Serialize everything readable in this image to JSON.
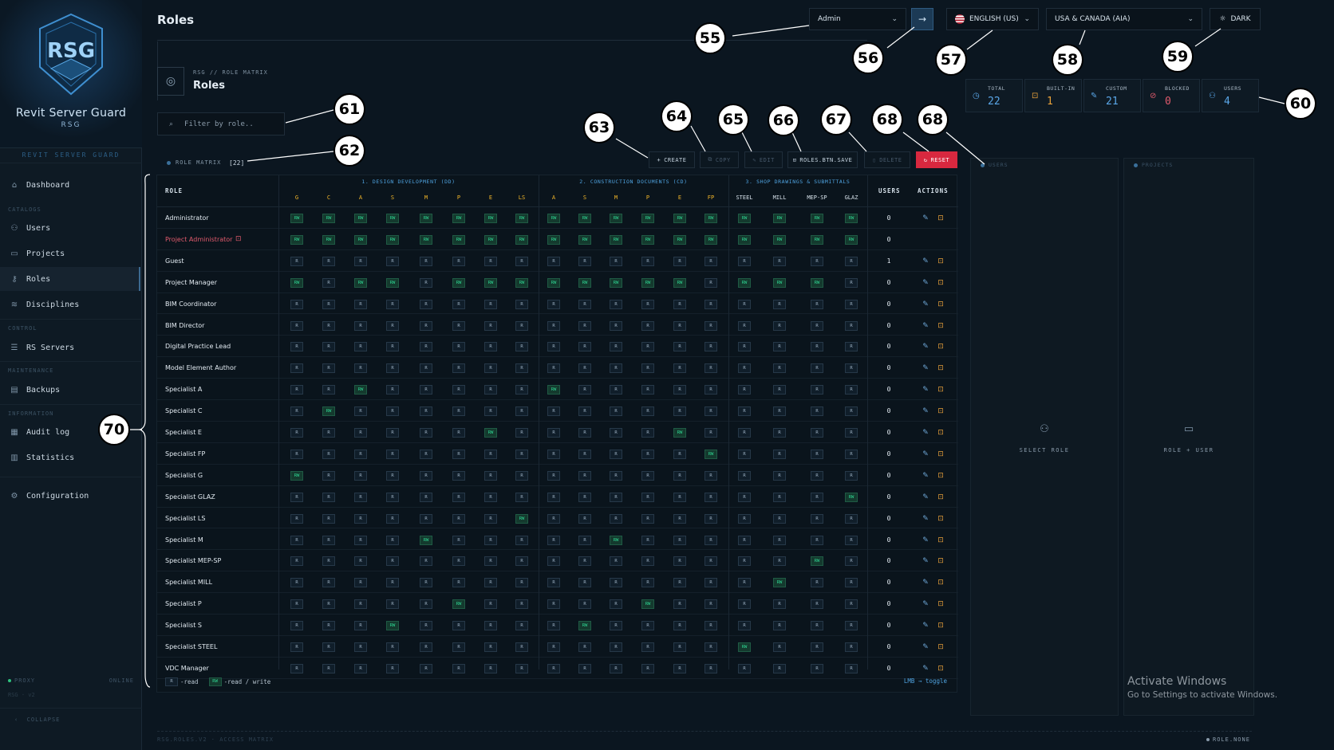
{
  "app": {
    "brand_title": "Revit Server Guard",
    "brand_subtitle": "RSG",
    "brand_caption": "REVIT SERVER GUARD"
  },
  "sidebar": {
    "sections": [
      {
        "label": "CATALOGS"
      },
      {
        "label": "CONTROL"
      },
      {
        "label": "MAINTENANCE"
      },
      {
        "label": "INFORMATION"
      }
    ],
    "items": [
      {
        "label": "Dashboard",
        "icon": "home-icon"
      },
      {
        "label": "Users",
        "icon": "users-icon"
      },
      {
        "label": "Projects",
        "icon": "folder-icon"
      },
      {
        "label": "Roles",
        "icon": "key-icon",
        "active": true
      },
      {
        "label": "Disciplines",
        "icon": "layers-icon"
      },
      {
        "label": "RS Servers",
        "icon": "server-icon"
      },
      {
        "label": "Backups",
        "icon": "archive-icon"
      },
      {
        "label": "Audit log",
        "icon": "log-icon"
      },
      {
        "label": "Statistics",
        "icon": "chart-icon"
      },
      {
        "label": "Configuration",
        "icon": "gear-icon"
      }
    ],
    "status_left": "PROXY",
    "status_right": "ONLINE",
    "version": "RSG · v2",
    "collapse_label": "COLLAPSE"
  },
  "header": {
    "page_title": "Roles",
    "user_select": "Admin",
    "language": "ENGLISH (US)",
    "region": "USA & CANADA (AIA)",
    "theme_label": "DARK",
    "crumb": "RSG // ROLE MATRIX",
    "section_title": "Roles"
  },
  "search": {
    "placeholder": "Filter by role.."
  },
  "stats": [
    {
      "label": "TOTAL",
      "value": "22",
      "color": "#5aa7e8",
      "icon": "clock-icon"
    },
    {
      "label": "BUILT-IN",
      "value": "1",
      "color": "#e8a13a",
      "icon": "lock-icon"
    },
    {
      "label": "CUSTOM",
      "value": "21",
      "color": "#5aa7e8",
      "icon": "pencil-icon"
    },
    {
      "label": "BLOCKED",
      "value": "0",
      "color": "#e05a6c",
      "icon": "block-icon"
    },
    {
      "label": "USERS",
      "value": "4",
      "color": "#5aa7e8",
      "icon": "users-icon"
    }
  ],
  "toolbar": {
    "matrix_caption": "ROLE MATRIX",
    "matrix_count": "[22]",
    "create": "CREATE",
    "copy": "COPY",
    "edit": "EDIT",
    "save": "ROLES.BTN.SAVE",
    "delete": "DELETE",
    "reset": "RESET"
  },
  "matrix": {
    "groups": [
      "1. DESIGN DEVELOPMENT (DD)",
      "2. CONSTRUCTION DOCUMENTS (CD)",
      "3. SHOP DRAWINGS & SUBMITTALS"
    ],
    "col_role": "ROLE",
    "col_users": "USERS",
    "col_actions": "ACTIONS",
    "columns": [
      "G",
      "C",
      "A",
      "S",
      "M",
      "P",
      "E",
      "LS",
      "A",
      "S",
      "M",
      "P",
      "E",
      "FP",
      "STEEL",
      "MILL",
      "MEP-SP",
      "GLAZ"
    ],
    "rows": [
      {
        "name": "Administrator",
        "users": "0",
        "builtin": false,
        "perms": [
          "RW",
          "RW",
          "RW",
          "RW",
          "RW",
          "RW",
          "RW",
          "RW",
          "RW",
          "RW",
          "RW",
          "RW",
          "RW",
          "RW",
          "RW",
          "RW",
          "RW",
          "RW"
        ],
        "actions": true
      },
      {
        "name": "Project Administrator",
        "users": "0",
        "builtin": true,
        "perms": [
          "RW",
          "RW",
          "RW",
          "RW",
          "RW",
          "RW",
          "RW",
          "RW",
          "RW",
          "RW",
          "RW",
          "RW",
          "RW",
          "RW",
          "RW",
          "RW",
          "RW",
          "RW"
        ],
        "actions": false
      },
      {
        "name": "Guest",
        "users": "1",
        "perms": [
          "R",
          "R",
          "R",
          "R",
          "R",
          "R",
          "R",
          "R",
          "R",
          "R",
          "R",
          "R",
          "R",
          "R",
          "R",
          "R",
          "R",
          "R"
        ],
        "actions": true
      },
      {
        "name": "Project Manager",
        "users": "0",
        "perms": [
          "RW",
          "R",
          "RW",
          "RW",
          "R",
          "RW",
          "RW",
          "RW",
          "RW",
          "RW",
          "RW",
          "RW",
          "RW",
          "R",
          "RW",
          "RW",
          "RW",
          "R"
        ],
        "actions": true
      },
      {
        "name": "BIM Coordinator",
        "users": "0",
        "perms": [
          "R",
          "R",
          "R",
          "R",
          "R",
          "R",
          "R",
          "R",
          "R",
          "R",
          "R",
          "R",
          "R",
          "R",
          "R",
          "R",
          "R",
          "R"
        ],
        "actions": true
      },
      {
        "name": "BIM Director",
        "users": "0",
        "perms": [
          "R",
          "R",
          "R",
          "R",
          "R",
          "R",
          "R",
          "R",
          "R",
          "R",
          "R",
          "R",
          "R",
          "R",
          "R",
          "R",
          "R",
          "R"
        ],
        "actions": true
      },
      {
        "name": "Digital Practice Lead",
        "users": "0",
        "perms": [
          "R",
          "R",
          "R",
          "R",
          "R",
          "R",
          "R",
          "R",
          "R",
          "R",
          "R",
          "R",
          "R",
          "R",
          "R",
          "R",
          "R",
          "R"
        ],
        "actions": true
      },
      {
        "name": "Model Element Author",
        "users": "0",
        "perms": [
          "R",
          "R",
          "R",
          "R",
          "R",
          "R",
          "R",
          "R",
          "R",
          "R",
          "R",
          "R",
          "R",
          "R",
          "R",
          "R",
          "R",
          "R"
        ],
        "actions": true
      },
      {
        "name": "Specialist A",
        "users": "0",
        "perms": [
          "R",
          "R",
          "RW",
          "R",
          "R",
          "R",
          "R",
          "R",
          "RW",
          "R",
          "R",
          "R",
          "R",
          "R",
          "R",
          "R",
          "R",
          "R"
        ],
        "actions": true
      },
      {
        "name": "Specialist C",
        "users": "0",
        "perms": [
          "R",
          "RW",
          "R",
          "R",
          "R",
          "R",
          "R",
          "R",
          "R",
          "R",
          "R",
          "R",
          "R",
          "R",
          "R",
          "R",
          "R",
          "R"
        ],
        "actions": true
      },
      {
        "name": "Specialist E",
        "users": "0",
        "perms": [
          "R",
          "R",
          "R",
          "R",
          "R",
          "R",
          "RW",
          "R",
          "R",
          "R",
          "R",
          "R",
          "RW",
          "R",
          "R",
          "R",
          "R",
          "R"
        ],
        "actions": true
      },
      {
        "name": "Specialist FP",
        "users": "0",
        "perms": [
          "R",
          "R",
          "R",
          "R",
          "R",
          "R",
          "R",
          "R",
          "R",
          "R",
          "R",
          "R",
          "R",
          "RW",
          "R",
          "R",
          "R",
          "R"
        ],
        "actions": true
      },
      {
        "name": "Specialist G",
        "users": "0",
        "perms": [
          "RW",
          "R",
          "R",
          "R",
          "R",
          "R",
          "R",
          "R",
          "R",
          "R",
          "R",
          "R",
          "R",
          "R",
          "R",
          "R",
          "R",
          "R"
        ],
        "actions": true
      },
      {
        "name": "Specialist GLAZ",
        "users": "0",
        "perms": [
          "R",
          "R",
          "R",
          "R",
          "R",
          "R",
          "R",
          "R",
          "R",
          "R",
          "R",
          "R",
          "R",
          "R",
          "R",
          "R",
          "R",
          "RW"
        ],
        "actions": true
      },
      {
        "name": "Specialist LS",
        "users": "0",
        "perms": [
          "R",
          "R",
          "R",
          "R",
          "R",
          "R",
          "R",
          "RW",
          "R",
          "R",
          "R",
          "R",
          "R",
          "R",
          "R",
          "R",
          "R",
          "R"
        ],
        "actions": true
      },
      {
        "name": "Specialist M",
        "users": "0",
        "perms": [
          "R",
          "R",
          "R",
          "R",
          "RW",
          "R",
          "R",
          "R",
          "R",
          "R",
          "RW",
          "R",
          "R",
          "R",
          "R",
          "R",
          "R",
          "R"
        ],
        "actions": true
      },
      {
        "name": "Specialist MEP-SP",
        "users": "0",
        "perms": [
          "R",
          "R",
          "R",
          "R",
          "R",
          "R",
          "R",
          "R",
          "R",
          "R",
          "R",
          "R",
          "R",
          "R",
          "R",
          "R",
          "RW",
          "R"
        ],
        "actions": true
      },
      {
        "name": "Specialist MILL",
        "users": "0",
        "perms": [
          "R",
          "R",
          "R",
          "R",
          "R",
          "R",
          "R",
          "R",
          "R",
          "R",
          "R",
          "R",
          "R",
          "R",
          "R",
          "RW",
          "R",
          "R"
        ],
        "actions": true
      },
      {
        "name": "Specialist P",
        "users": "0",
        "perms": [
          "R",
          "R",
          "R",
          "R",
          "R",
          "RW",
          "R",
          "R",
          "R",
          "R",
          "R",
          "RW",
          "R",
          "R",
          "R",
          "R",
          "R",
          "R"
        ],
        "actions": true
      },
      {
        "name": "Specialist S",
        "users": "0",
        "perms": [
          "R",
          "R",
          "R",
          "RW",
          "R",
          "R",
          "R",
          "R",
          "R",
          "RW",
          "R",
          "R",
          "R",
          "R",
          "R",
          "R",
          "R",
          "R"
        ],
        "actions": true
      },
      {
        "name": "Specialist STEEL",
        "users": "0",
        "perms": [
          "R",
          "R",
          "R",
          "R",
          "R",
          "R",
          "R",
          "R",
          "R",
          "R",
          "R",
          "R",
          "R",
          "R",
          "RW",
          "R",
          "R",
          "R"
        ],
        "actions": true
      },
      {
        "name": "VDC Manager",
        "users": "0",
        "perms": [
          "R",
          "R",
          "R",
          "R",
          "R",
          "R",
          "R",
          "R",
          "R",
          "R",
          "R",
          "R",
          "R",
          "R",
          "R",
          "R",
          "R",
          "R"
        ],
        "actions": true
      }
    ],
    "legend_r": "R",
    "legend_r_text": "-read",
    "legend_rw": "RW",
    "legend_rw_text": "-read / write",
    "toggle_hint": "LMB → toggle"
  },
  "panels": {
    "users_title": "USERS",
    "users_msg": "SELECT ROLE",
    "projects_title": "PROJECTS",
    "projects_msg": "ROLE + USER"
  },
  "footer": {
    "left": "RSG.ROLES.V2 · ACCESS MATRIX",
    "right": "ROLE.NONE"
  },
  "os_watermark": {
    "title": "Activate Windows",
    "sub": "Go to Settings to activate Windows."
  },
  "callouts": [
    "55",
    "56",
    "57",
    "58",
    "59",
    "60",
    "61",
    "62",
    "63",
    "64",
    "65",
    "66",
    "67",
    "68",
    "68",
    "70"
  ]
}
